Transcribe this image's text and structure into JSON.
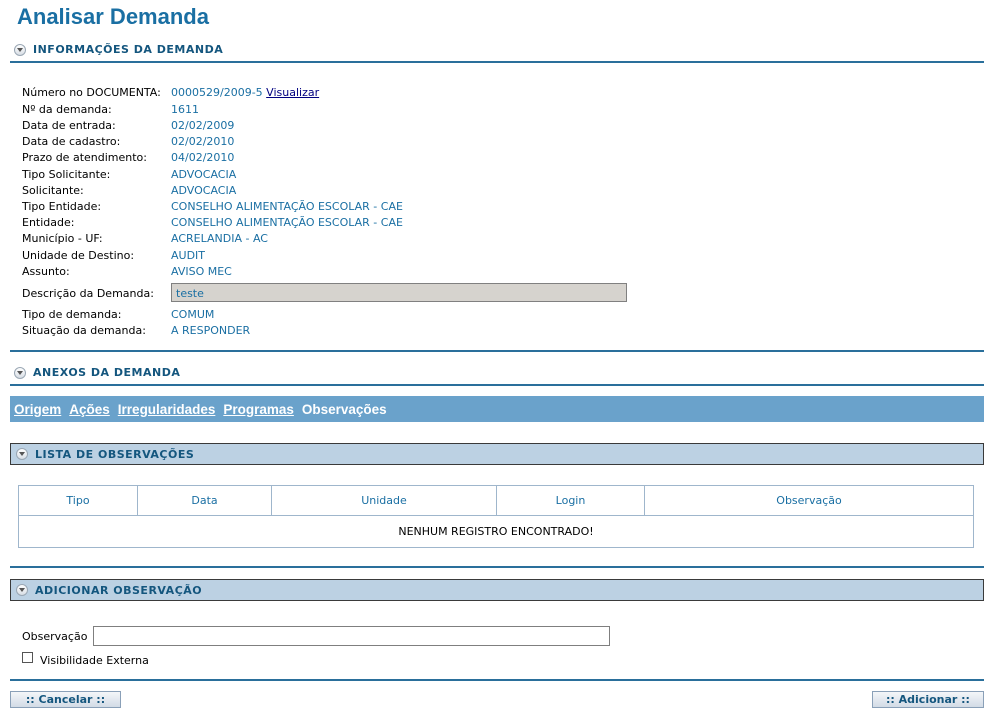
{
  "page_title": "Analisar Demanda",
  "sections": {
    "informacoes": "INFORMAÇÕES DA DEMANDA",
    "anexos": "ANEXOS DA DEMANDA",
    "lista": "LISTA DE OBSERVAÇÕES",
    "adicionar": "ADICIONAR OBSERVAÇÃO"
  },
  "info": {
    "numero_label": "Número no DOCUMENTA:",
    "numero_value": "0000529/2009-5",
    "visualizar_link": "Visualizar",
    "demanda_label": "Nº da demanda:",
    "demanda_value": "1611",
    "entrada_label": "Data de entrada:",
    "entrada_value": "02/02/2009",
    "cadastro_label": "Data de cadastro:",
    "cadastro_value": "02/02/2010",
    "prazo_label": "Prazo de atendimento:",
    "prazo_value": "04/02/2010",
    "tipo_solicitante_label": "Tipo Solicitante:",
    "tipo_solicitante_value": "ADVOCACIA",
    "solicitante_label": "Solicitante:",
    "solicitante_value": "ADVOCACIA",
    "tipo_entidade_label": "Tipo Entidade:",
    "tipo_entidade_value": "CONSELHO ALIMENTAÇÃO ESCOLAR - CAE",
    "entidade_label": "Entidade:",
    "entidade_value": "CONSELHO ALIMENTAÇÃO ESCOLAR - CAE",
    "municipio_label": "Município - UF:",
    "municipio_value": "ACRELANDIA - AC",
    "unidade_label": "Unidade de Destino:",
    "unidade_value": "AUDIT",
    "assunto_label": "Assunto:",
    "assunto_value": "AVISO MEC",
    "descricao_label": "Descrição da Demanda:",
    "descricao_value": "teste",
    "tipo_demanda_label": "Tipo de demanda:",
    "tipo_demanda_value": "COMUM",
    "situacao_label": "Situação da demanda:",
    "situacao_value": "A RESPONDER"
  },
  "tabs": [
    "Origem",
    "Ações",
    "Irregularidades",
    "Programas",
    "Observações"
  ],
  "table": {
    "headers": [
      "Tipo",
      "Data",
      "Unidade",
      "Login",
      "Observação"
    ],
    "empty_message": "NENHUM REGISTRO ENCONTRADO!"
  },
  "form": {
    "observacao_label": "Observação",
    "observacao_value": "",
    "visibilidade_label": "Visibilidade Externa",
    "visibilidade_checked": false
  },
  "buttons": {
    "cancelar": ":: Cancelar ::",
    "adicionar": ":: Adicionar ::"
  },
  "colors": {
    "title": "#1a6fa3",
    "tabbar": "#6aa2cb",
    "box_header": "#bcd1e3"
  }
}
